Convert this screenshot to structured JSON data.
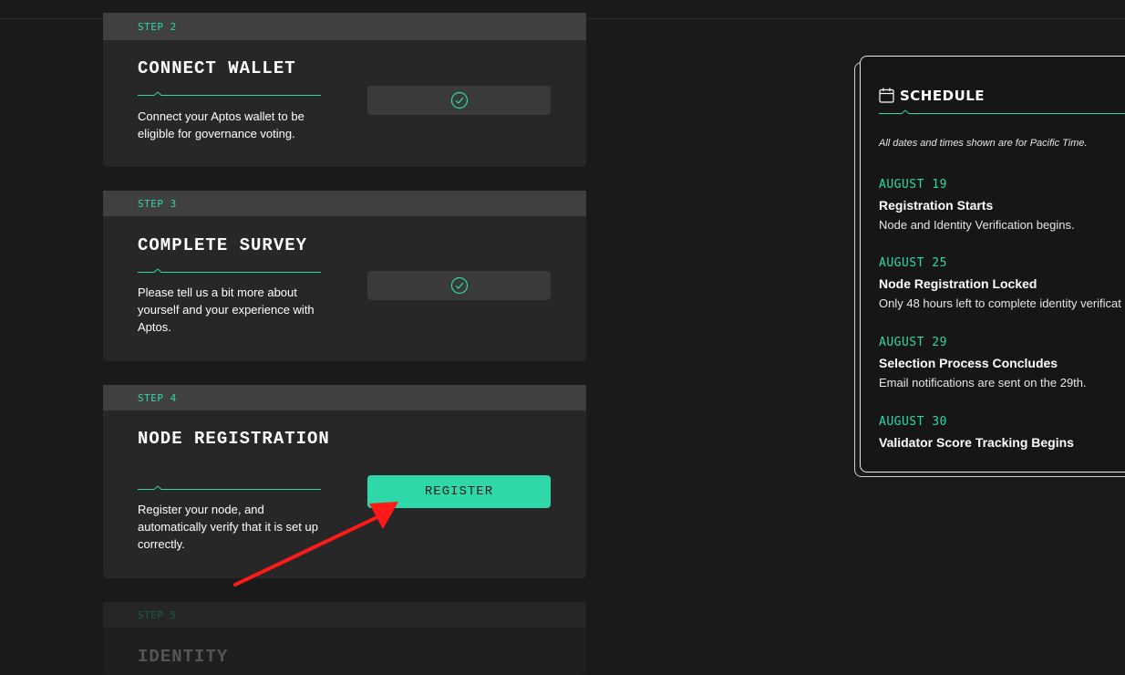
{
  "steps": [
    {
      "step_label": "STEP 2",
      "title": "CONNECT WALLET",
      "description": "Connect your Aptos wallet to be eligible for governance voting.",
      "status": "completed"
    },
    {
      "step_label": "STEP 3",
      "title": "COMPLETE SURVEY",
      "description": "Please tell us a bit more about yourself and your experience with Aptos.",
      "status": "completed"
    },
    {
      "step_label": "STEP 4",
      "title": "NODE REGISTRATION",
      "description": "Register your node, and automatically verify that it is set up correctly.",
      "button_label": "REGISTER",
      "status": "active"
    },
    {
      "step_label": "STEP 5",
      "title": "IDENTITY",
      "status": "locked"
    }
  ],
  "schedule": {
    "title": "SCHEDULE",
    "note": "All dates and times shown are for Pacific Time.",
    "events": [
      {
        "date": "AUGUST 19",
        "title": "Registration Starts",
        "description": "Node and Identity Verification begins."
      },
      {
        "date": "AUGUST 25",
        "title": "Node Registration Locked",
        "description": "Only 48 hours left to complete identity verificat"
      },
      {
        "date": "AUGUST 29",
        "title": "Selection Process Concludes",
        "description": "Email notifications are sent on the 29th."
      },
      {
        "date": "AUGUST 30",
        "title": "Validator Score Tracking Begins"
      }
    ]
  },
  "colors": {
    "accent": "#2ed8a8",
    "background": "#1a1a1a",
    "card": "#272727",
    "card_header": "#404040",
    "annotation_arrow": "#ff0000"
  },
  "icons": {
    "step_complete": "check-circle-icon",
    "schedule": "calendar-icon"
  }
}
